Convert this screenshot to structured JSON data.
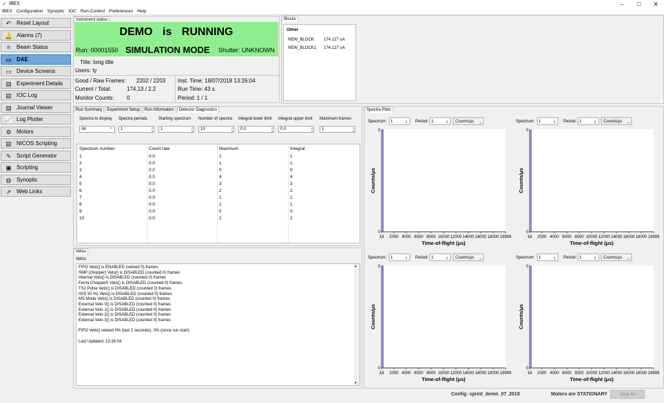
{
  "app": {
    "title": "IBEX"
  },
  "window_controls": {
    "minimize": "–",
    "maximize": "□",
    "close": "✕"
  },
  "menu": [
    "IBEX",
    "Configuration",
    "Synoptic",
    "IOC",
    "Run-Control",
    "Preferences",
    "Help"
  ],
  "perspectives": [
    {
      "label": "Reset Layout",
      "icon": "reset-icon",
      "glyph": "↶"
    },
    {
      "label": "Alarms (7)",
      "icon": "alarm-bell-icon",
      "glyph": "🔔"
    },
    {
      "label": "Beam Status",
      "icon": "atom-icon",
      "glyph": "⚛"
    },
    {
      "label": "DAE",
      "icon": "dae-icon",
      "glyph": "▭",
      "selected": true
    },
    {
      "label": "Device Screens",
      "icon": "device-screens-icon",
      "glyph": "▭"
    },
    {
      "label": "Experiment Details",
      "icon": "experiment-details-icon",
      "glyph": "▤"
    },
    {
      "label": "IOC Log",
      "icon": "ioc-log-icon",
      "glyph": "▤"
    },
    {
      "label": "Journal Viewer",
      "icon": "journal-icon",
      "glyph": "▤"
    },
    {
      "label": "Log Plotter",
      "icon": "log-plotter-icon",
      "glyph": "📈"
    },
    {
      "label": "Motors",
      "icon": "motors-icon",
      "glyph": "⚙"
    },
    {
      "label": "NICOS Scripting",
      "icon": "nicos-icon",
      "glyph": "▤"
    },
    {
      "label": "Script Generator",
      "icon": "script-generator-icon",
      "glyph": "✎"
    },
    {
      "label": "Scripting",
      "icon": "scripting-icon",
      "glyph": "▣"
    },
    {
      "label": "Synoptic",
      "icon": "synoptic-icon",
      "glyph": "◍"
    },
    {
      "label": "Web Links",
      "icon": "web-links-icon",
      "glyph": "⇗"
    }
  ],
  "instrument_status": {
    "header": "Instrument status",
    "banner": "DEMO is RUNNING",
    "run_number": "Run: 00001550",
    "mode": "SIMULATION MODE",
    "shutter": "Shutter: UNKNOWN",
    "title": "Title: long title",
    "users": "Users: ty",
    "good_raw_label": "Good / Raw Frames:",
    "good_raw_value": "2202 / 2203",
    "current_total_label": "Current / Total:",
    "current_total_value": "174.13 / 2.2",
    "monitor_label": "Monitor Counts:",
    "monitor_value": "0",
    "inst_time": "Inst. Time: 18/07/2018 13:26:04",
    "run_time": "Run Time: 43 s",
    "period": "Period: 1 / 1",
    "banner_color": "#90ee90"
  },
  "blocks": {
    "header": "Blocks",
    "group": "Other",
    "items": [
      {
        "name": "NEW_BLOCK:",
        "value": "174.127 uA"
      },
      {
        "name": "NEW_BLOCK1:",
        "value": "174.127 uA"
      }
    ]
  },
  "dae_tabs": [
    "Run Summary",
    "Experiment Setup",
    "Run Information",
    "Detector Diagnostics"
  ],
  "diagnostics": {
    "filter_labels": [
      "Spectra to display",
      "Spectra periods",
      "Starting spectrum",
      "Number of spectra",
      "Integral lower limit",
      "Integral upper limit",
      "Maximum frames"
    ],
    "filter_values": [
      "All",
      "1",
      "1",
      "10",
      "0.0",
      "0.0",
      "1"
    ],
    "columns": [
      "Spectrum number",
      "Count rate",
      "Maximum",
      "Integral"
    ],
    "rows": [
      [
        "1",
        "0.0",
        "1",
        "1"
      ],
      [
        "2",
        "0.0",
        "1",
        "1"
      ],
      [
        "3",
        "0.0",
        "0",
        "0"
      ],
      [
        "4",
        "0.0",
        "4",
        "4"
      ],
      [
        "5",
        "0.0",
        "3",
        "3"
      ],
      [
        "6",
        "0.0",
        "2",
        "2"
      ],
      [
        "7",
        "0.0",
        "1",
        "1"
      ],
      [
        "8",
        "0.0",
        "1",
        "1"
      ],
      [
        "9",
        "0.0",
        "0",
        "0"
      ],
      [
        "10",
        "0.0",
        "2",
        "2"
      ]
    ]
  },
  "vetos": {
    "tab": "Vetos",
    "header": "Vetos",
    "lines": [
      "FIFO Veto() is ENABLED (vetoed 0) frames",
      "SMP (chopper) Veto() is DISABLED (counted 0) frames",
      "Internal Veto() is DISABLED (counted 0) frames",
      "Fermi Chopper0 Veto() is DISABLED (counted 0) frames",
      "TS2 Pulse Veto() is DISABLED (counted 0) frames",
      "ISIS 50 Hz Veto() is DISABLED (counted 0) frames",
      "MS Mode Veto() is DISABLED (counted 0) frames",
      "External Veto 0() is DISABLED (counted 0) frames",
      "External Veto 1() is DISABLED (counted 0) frames",
      "External Veto 2() is DISABLED (counted 0) frames",
      "External Veto 3() is DISABLED (counted 0) frames",
      "",
      "FIFO Veto() vetoed 0% (last 2 seconds), 0% (since run start)",
      "",
      "Last Updated: 13:26:04"
    ]
  },
  "spectra": {
    "tab": "Spectra Plots",
    "spectrum_label": "Spectrum:",
    "period_label": "Period:",
    "units_label": "Counts/μs",
    "spectrum_value": "1",
    "period_value": "1",
    "line_color": "#3333cc"
  },
  "chart_data": [
    {
      "type": "line",
      "xlabel": "Time-of-flight (μs)",
      "ylabel": "Counts/μs",
      "x_ticks": [
        "18",
        "2000",
        "4000",
        "6000",
        "8000",
        "10000",
        "12000",
        "14000",
        "16000",
        "18000",
        "19999"
      ],
      "y_ticks": [
        "0",
        "0"
      ],
      "xlim": [
        18,
        19999
      ],
      "series": [
        {
          "x": [
            18,
            19999
          ],
          "y": [
            0,
            0
          ]
        }
      ]
    },
    {
      "type": "line",
      "xlabel": "Time-of-flight (μs)",
      "ylabel": "Counts/μs",
      "x_ticks": [
        "18",
        "2000",
        "4000",
        "6000",
        "8000",
        "10000",
        "12000",
        "14000",
        "16000",
        "18000",
        "19999"
      ],
      "y_ticks": [
        "0",
        "0"
      ],
      "xlim": [
        18,
        19999
      ],
      "series": [
        {
          "x": [
            18,
            19999
          ],
          "y": [
            0,
            0
          ]
        }
      ]
    },
    {
      "type": "line",
      "xlabel": "Time-of-flight (μs)",
      "ylabel": "Counts/μs",
      "x_ticks": [
        "18",
        "2000",
        "4000",
        "6000",
        "8000",
        "10000",
        "12000",
        "14000",
        "16000",
        "18000",
        "19999"
      ],
      "y_ticks": [
        "0",
        "0"
      ],
      "xlim": [
        18,
        19999
      ],
      "series": [
        {
          "x": [
            18,
            19999
          ],
          "y": [
            0,
            0
          ]
        }
      ]
    },
    {
      "type": "line",
      "xlabel": "Time-of-flight (μs)",
      "ylabel": "Counts/μs",
      "x_ticks": [
        "18",
        "2000",
        "4000",
        "6000",
        "8000",
        "10000",
        "12000",
        "14000",
        "16000",
        "18000",
        "19999"
      ],
      "y_ticks": [
        "0",
        "0"
      ],
      "xlim": [
        18,
        19999
      ],
      "series": [
        {
          "x": [
            18,
            19999
          ],
          "y": [
            0,
            0
          ]
        }
      ]
    }
  ],
  "statusbar": {
    "config": "Config: sprint_demo_07_2018",
    "motors": "Motors are STATIONARY",
    "stop_all": "Stop All"
  }
}
